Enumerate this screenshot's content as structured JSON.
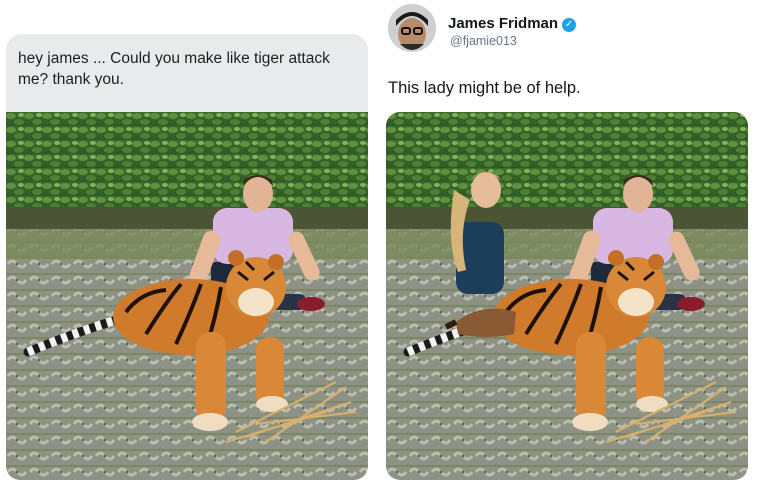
{
  "request": {
    "text": "hey james ... Could you make like tiger attack me? thank you."
  },
  "response": {
    "author_name": "James Fridman",
    "author_handle": "@fjamie013",
    "verified": true,
    "text": "This lady might be of help."
  },
  "icons": {
    "verified": "verified-badge-icon"
  },
  "colors": {
    "bubble": "#e9eaec",
    "verified_blue": "#1da1f2"
  }
}
